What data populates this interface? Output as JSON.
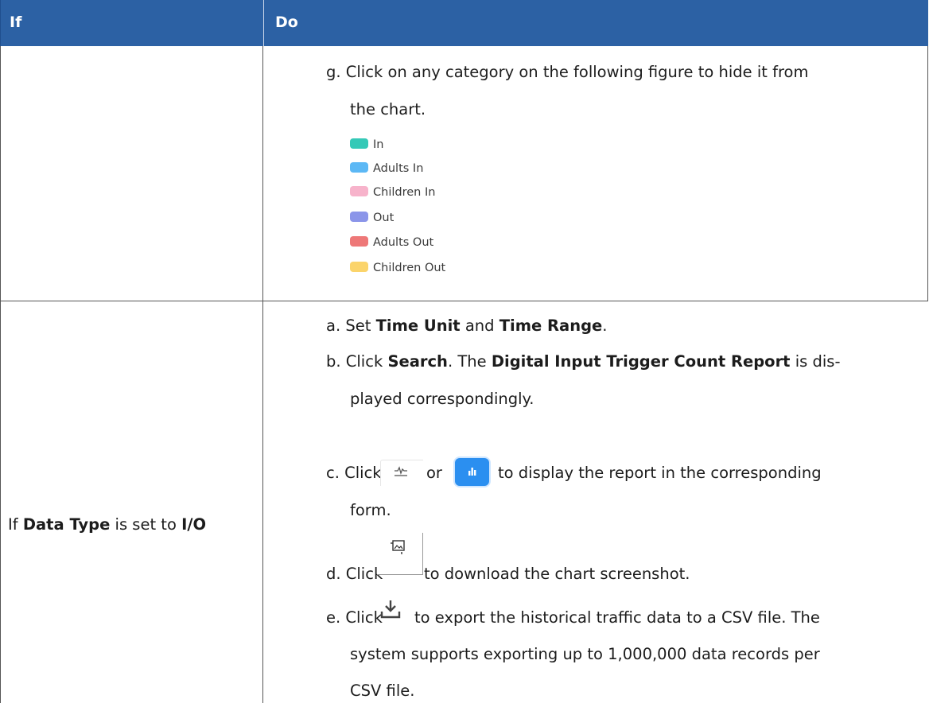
{
  "table": {
    "header": {
      "col_if": "If",
      "col_do": "Do"
    },
    "row1": {
      "step_g_line1": "g. Click on any category on the following figure to hide it from",
      "step_g_line2": "the chart.",
      "legend": [
        {
          "label": "In",
          "color": "#35c9b7"
        },
        {
          "label": "Adults In",
          "color": "#5cb8f5"
        },
        {
          "label": "Children In",
          "color": "#f7b3cb"
        },
        {
          "label": "Out",
          "color": "#8b95e9"
        },
        {
          "label": "Adults Out",
          "color": "#ee7878"
        },
        {
          "label": "Children Out",
          "color": "#fbd46b"
        }
      ]
    },
    "row2": {
      "condition": {
        "prefix": "If ",
        "field": "Data Type",
        "mid": " is set to ",
        "value": "I/O"
      },
      "step_a": {
        "p1": "a. Set ",
        "b1": "Time Unit",
        "p2": " and ",
        "b2": "Time Range",
        "p3": "."
      },
      "step_b_line1": {
        "p1": "b. Click ",
        "b1": "Search",
        "p2": ". The ",
        "b2": "Digital Input Trigger Count Report",
        "p3": " is dis-"
      },
      "step_b_line2": "played correspondingly.",
      "step_c": {
        "p1": "c. Click",
        "p2": "or",
        "p3": "to display the report in the corresponding"
      },
      "step_c_line2": "form.",
      "step_d": {
        "p1": "d. Click",
        "p2": "to download the chart screenshot."
      },
      "step_e_line1": {
        "p1": "e. Click",
        "p2": "to export the historical traffic data to a CSV file. The"
      },
      "step_e_line2": "system supports exporting up to 1,000,000 data records per",
      "step_e_line3": "CSV file."
    },
    "icons": {
      "line_chart": "line-chart-icon",
      "bar_chart": "bar-chart-icon",
      "screenshot": "image-screenshot-icon",
      "download": "download-icon",
      "accent": "#2b8ff0"
    }
  }
}
